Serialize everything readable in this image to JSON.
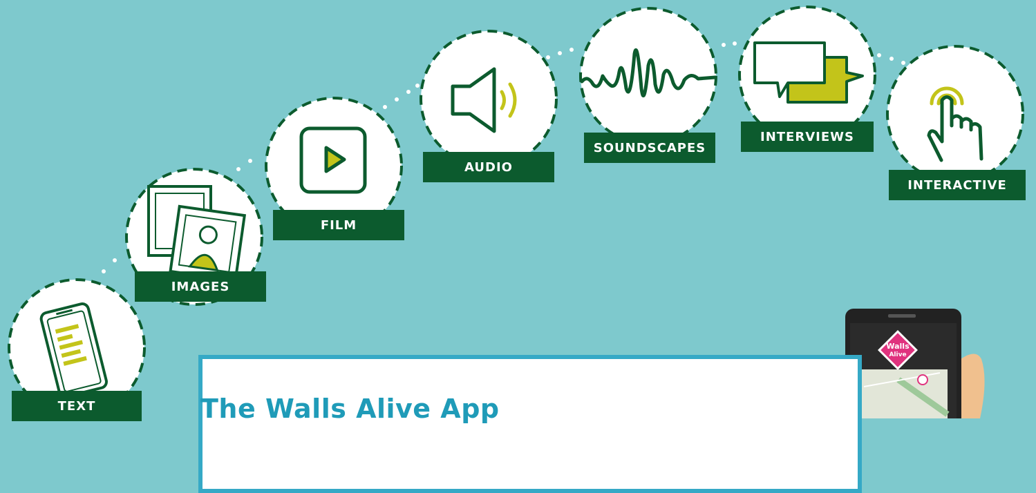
{
  "features": [
    {
      "id": "text",
      "label": "TEXT"
    },
    {
      "id": "images",
      "label": "IMAGES"
    },
    {
      "id": "film",
      "label": "FILM"
    },
    {
      "id": "audio",
      "label": "AUDIO"
    },
    {
      "id": "soundscapes",
      "label": "SOUNDSCAPES"
    },
    {
      "id": "interviews",
      "label": "INTERVIEWS"
    },
    {
      "id": "interactive",
      "label": "INTERACTIVE"
    }
  ],
  "card": {
    "title": "The Walls Alive App"
  },
  "phone": {
    "logo_text": "Walls Alive"
  },
  "colors": {
    "background": "#7ec9cd",
    "label_bg": "#0c5b2e",
    "icon_stroke": "#0c5b2e",
    "accent": "#c3c41a",
    "card_border": "#35a9c6",
    "title": "#1f9bb8",
    "logo_pink": "#e0327e"
  }
}
